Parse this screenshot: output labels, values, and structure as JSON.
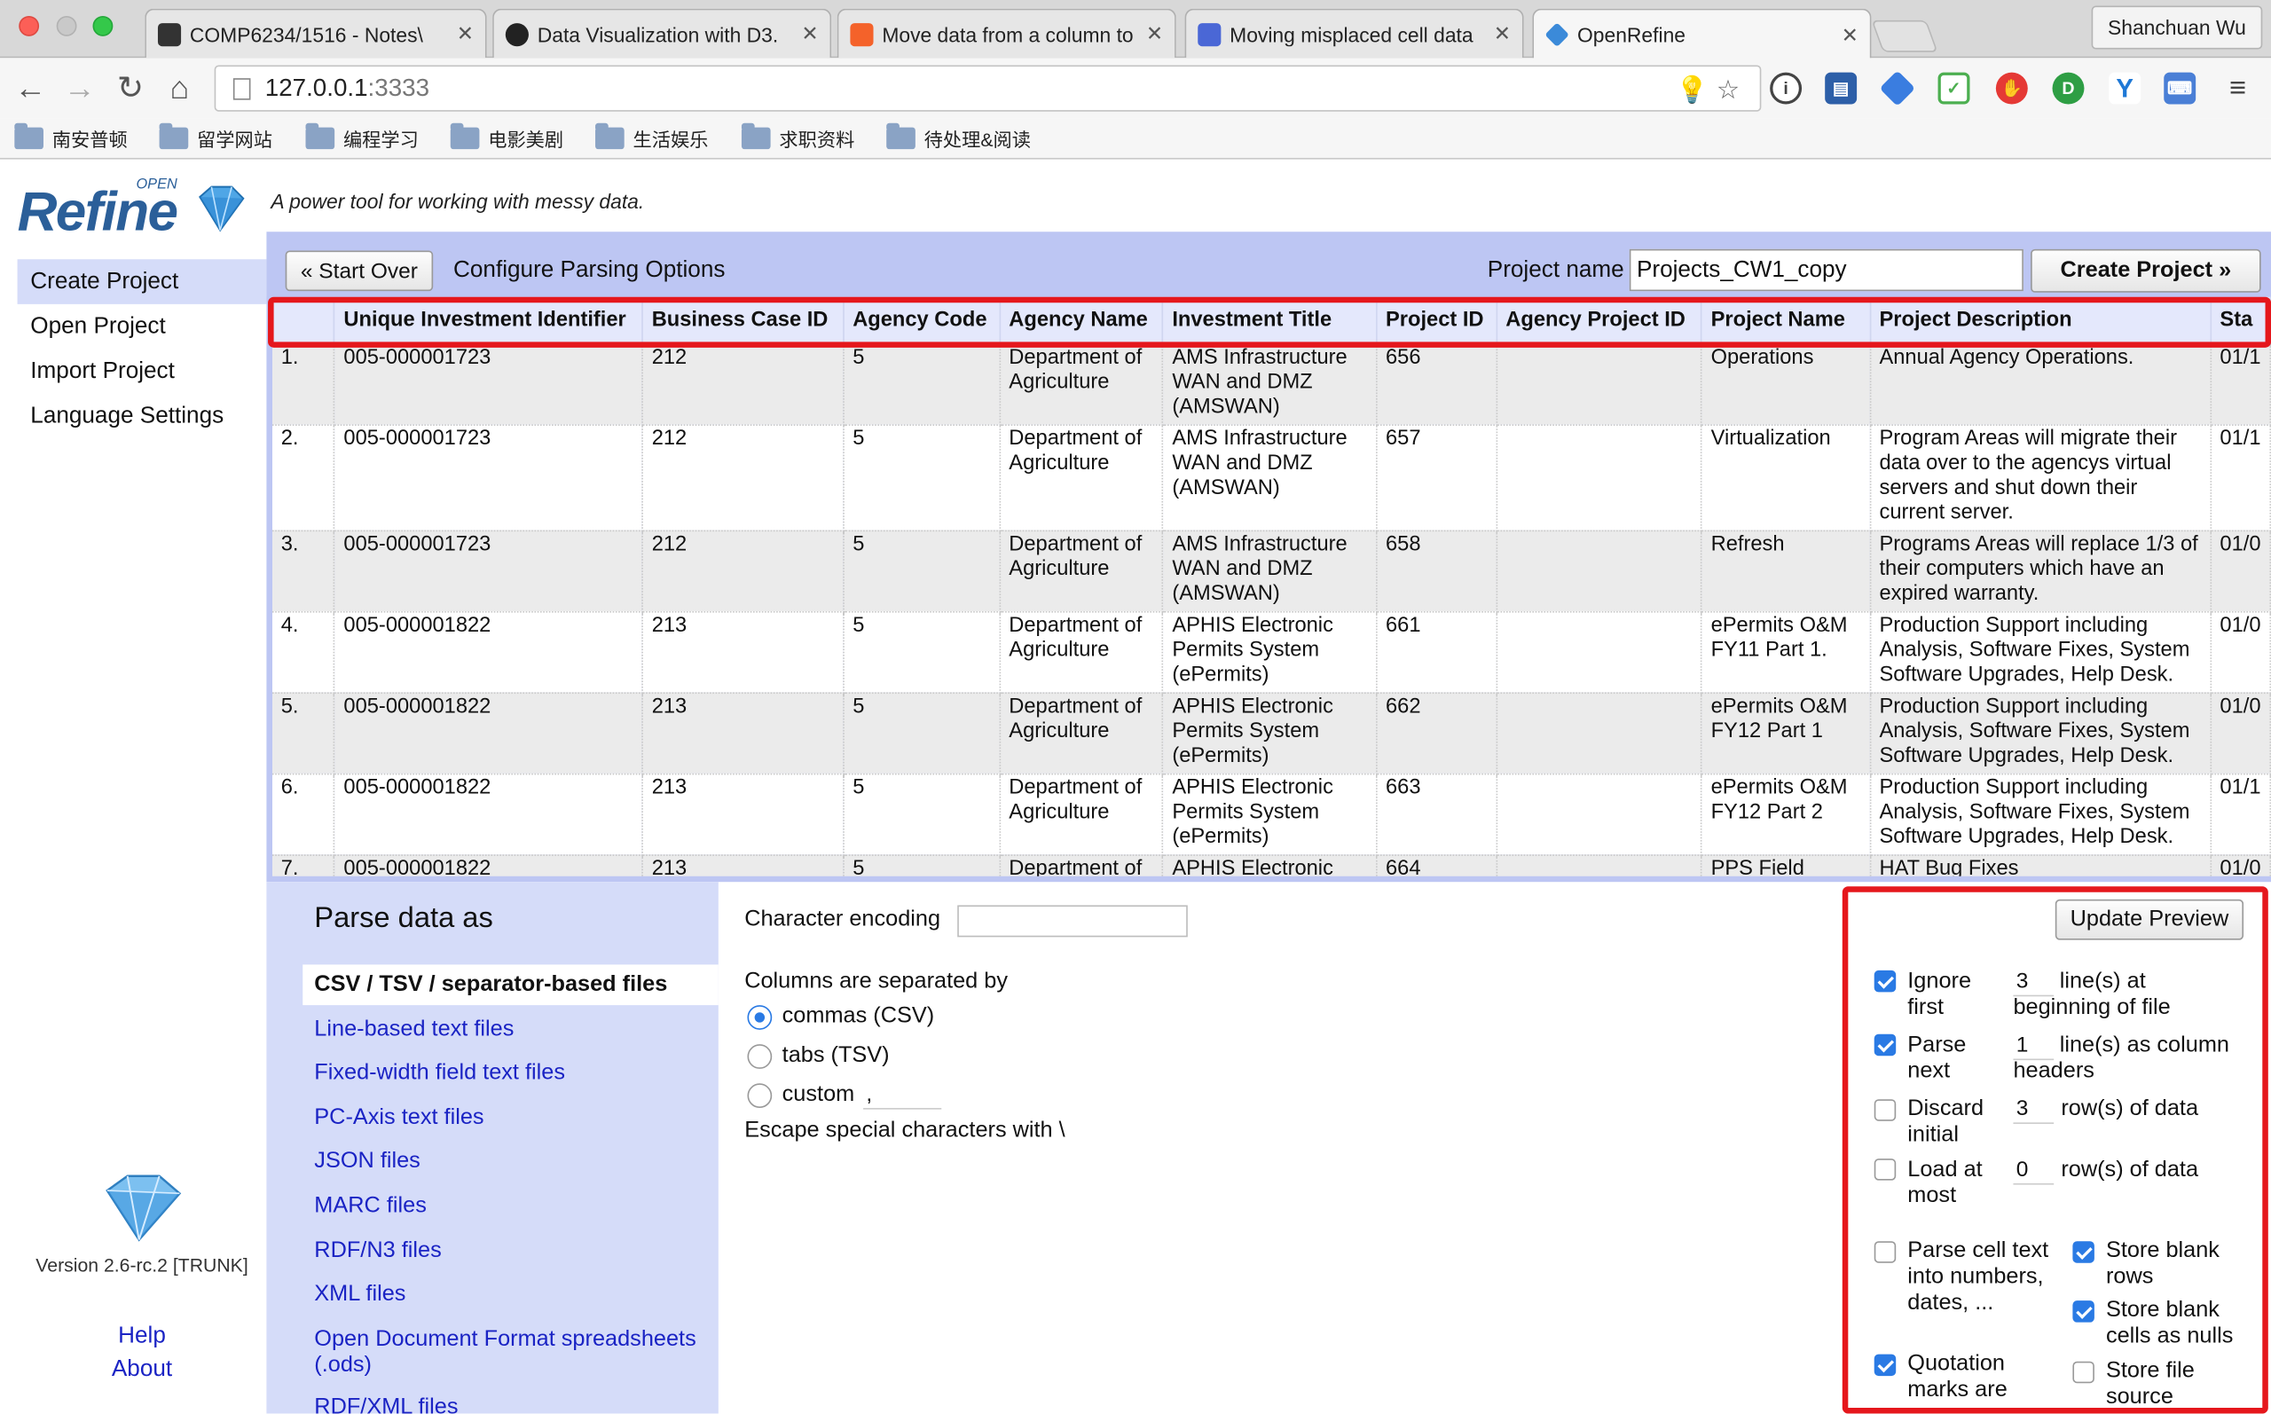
{
  "browser": {
    "tabs": [
      {
        "title": "COMP6234/1516 - Notes\\",
        "active": false,
        "favicon_color": "#333333"
      },
      {
        "title": "Data Visualization with D3.",
        "active": false,
        "favicon_color": "#222222"
      },
      {
        "title": "Move data from a column to",
        "active": false,
        "favicon_color": "#f4622a"
      },
      {
        "title": "Moving misplaced cell data",
        "active": false,
        "favicon_color": "#4a67d6"
      },
      {
        "title": "OpenRefine",
        "active": true,
        "favicon_color": "#3b8ad9"
      }
    ],
    "profile_name": "Shanchuan Wu",
    "url_host": "127.0.0.1",
    "url_port": ":3333",
    "bookmarks": [
      "南安普顿",
      "留学网站",
      "编程学习",
      "电影美剧",
      "生活娱乐",
      "求职资料",
      "待处理&阅读"
    ]
  },
  "app": {
    "tagline": "A power tool for working with messy data.",
    "nav": [
      "Create Project",
      "Open Project",
      "Import Project",
      "Language Settings"
    ],
    "version": "Version 2.6-rc.2 [TRUNK]",
    "help": "Help",
    "about": "About",
    "logo_small": "OPEN",
    "logo_big": "Refine"
  },
  "toolbar": {
    "start_over": "« Start Over",
    "configure_label": "Configure Parsing Options",
    "project_name_label": "Project name",
    "project_name_value": "Projects_CW1_copy",
    "create_project": "Create Project »"
  },
  "preview": {
    "columns": [
      "",
      "Unique Investment Identifier",
      "Business Case ID",
      "Agency Code",
      "Agency Name",
      "Investment Title",
      "Project ID",
      "Agency Project ID",
      "Project Name",
      "Project Description",
      "Sta"
    ],
    "rows": [
      [
        "1.",
        "005-000001723",
        "212",
        "5",
        "Department of Agriculture",
        "AMS Infrastructure WAN and DMZ (AMSWAN)",
        "656",
        "",
        "Operations",
        "Annual Agency Operations.",
        "01/1"
      ],
      [
        "2.",
        "005-000001723",
        "212",
        "5",
        "Department of Agriculture",
        "AMS Infrastructure WAN and DMZ (AMSWAN)",
        "657",
        "",
        "Virtualization",
        "Program Areas will migrate their data over to the agencys virtual servers and shut down their current server.",
        "01/1"
      ],
      [
        "3.",
        "005-000001723",
        "212",
        "5",
        "Department of Agriculture",
        "AMS Infrastructure WAN and DMZ (AMSWAN)",
        "658",
        "",
        "Refresh",
        "Programs Areas will replace 1/3 of their computers which have an expired warranty.",
        "01/0"
      ],
      [
        "4.",
        "005-000001822",
        "213",
        "5",
        "Department of Agriculture",
        "APHIS Electronic Permits System (ePermits)",
        "661",
        "",
        "ePermits O&M FY11 Part 1.",
        "Production Support including Analysis, Software Fixes, System Software Upgrades, Help Desk.",
        "01/0"
      ],
      [
        "5.",
        "005-000001822",
        "213",
        "5",
        "Department of Agriculture",
        "APHIS Electronic Permits System (ePermits)",
        "662",
        "",
        "ePermits O&M FY12 Part 1",
        "Production Support including Analysis, Software Fixes, System Software Upgrades, Help Desk.",
        "01/0"
      ],
      [
        "6.",
        "005-000001822",
        "213",
        "5",
        "Department of Agriculture",
        "APHIS Electronic Permits System (ePermits)",
        "663",
        "",
        "ePermits O&M FY12 Part 2",
        "Production Support including Analysis, Software Fixes, System Software Upgrades, Help Desk.",
        "01/1"
      ],
      [
        "7.",
        "005-000001822",
        "213",
        "5",
        "Department of Agriculture",
        "APHIS Electronic Permits System (ePermits)",
        "664",
        "",
        "PPS Field",
        "HAT Bug Fixes",
        "01/0"
      ]
    ]
  },
  "parse": {
    "title": "Parse data as",
    "formats": [
      "CSV / TSV / separator-based files",
      "Line-based text files",
      "Fixed-width field text files",
      "PC-Axis text files",
      "JSON files",
      "MARC files",
      "RDF/N3 files",
      "XML files",
      "Open Document Format spreadsheets (.ods)",
      "RDF/XML files"
    ],
    "encoding_label": "Character encoding",
    "encoding_value": "",
    "separator_label": "Columns are separated by",
    "sep_commas": "commas (CSV)",
    "sep_tabs": "tabs (TSV)",
    "sep_custom": "custom",
    "custom_value": ",",
    "escape_label": "Escape special characters with \\",
    "update_preview": "Update Preview",
    "ignore_first": {
      "checked": true,
      "label": "Ignore first",
      "value": "3",
      "suffix": "line(s) at beginning of file"
    },
    "parse_next": {
      "checked": true,
      "label": "Parse next",
      "value": "1",
      "suffix": "line(s) as column headers"
    },
    "discard_initial": {
      "checked": false,
      "label": "Discard initial",
      "value": "3",
      "suffix": "row(s) of data"
    },
    "load_at_most": {
      "checked": false,
      "label": "Load at most",
      "value": "0",
      "suffix": "row(s) of data"
    },
    "parse_cell": {
      "checked": false,
      "label": "Parse cell text into numbers, dates, ..."
    },
    "quotation": {
      "checked": true,
      "label": "Quotation marks are"
    },
    "store_blank_rows": {
      "checked": true,
      "label": "Store blank rows"
    },
    "store_blank_nulls": {
      "checked": true,
      "label": "Store blank cells as nulls"
    },
    "store_file_source": {
      "checked": false,
      "label": "Store file source"
    }
  },
  "colors": {
    "accent_band": "#bdc6f3",
    "highlight": "#e5171c",
    "link": "#1a23c4"
  }
}
